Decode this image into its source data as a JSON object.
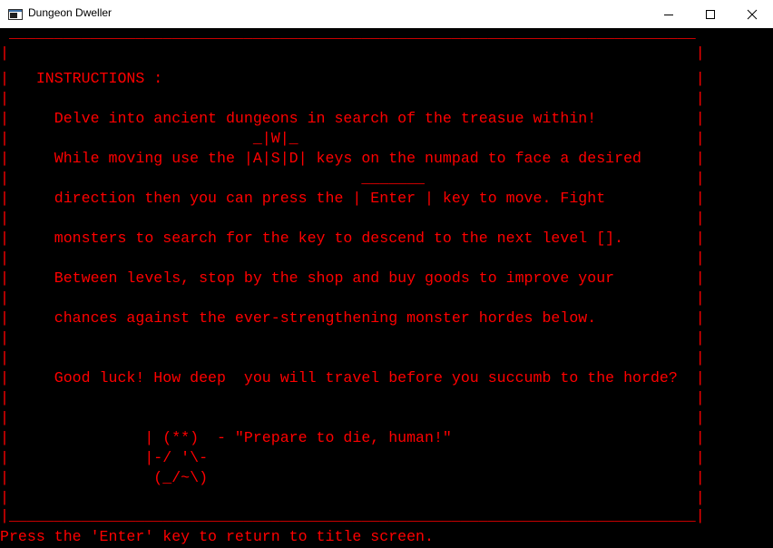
{
  "window": {
    "title": "Dungeon Dweller",
    "buttons": {
      "minimize_icon": "minimize-icon",
      "maximize_icon": "maximize-icon",
      "close_icon": "close-icon"
    }
  },
  "console": {
    "text_color": "#ff0000",
    "background": "#000000",
    "lines": [
      " ____________________________________________________________________________",
      "|                                                                            |",
      "|   INSTRUCTIONS :                                                           |",
      "|                                                                            |",
      "|     Delve into ancient dungeons in search of the treasue within!           |",
      "|                           _|W|_                                            |",
      "|     While moving use the |A|S|D| keys on the numpad to face a desired      |",
      "|                                       _______                              |",
      "|     direction then you can press the | Enter | key to move. Fight          |",
      "|                                                                            |",
      "|     monsters to search for the key to descend to the next level [].        |",
      "|                                                                            |",
      "|     Between levels, stop by the shop and buy goods to improve your         |",
      "|                                                                            |",
      "|     chances against the ever-strengthening monster hordes below.           |",
      "|                                                                            |",
      "|                                                                            |",
      "|     Good luck! How deep  you will travel before you succumb to the horde?  |",
      "|                                                                            |",
      "|                                                                            |",
      "|               | (**)  - \"Prepare to die, human!\"                           |",
      "|               |-/ '\\-                                                      |",
      "|                (_/~\\)                                                      |",
      "|                                                                            |",
      "|____________________________________________________________________________|",
      "Press the 'Enter' key to return to title screen."
    ]
  }
}
